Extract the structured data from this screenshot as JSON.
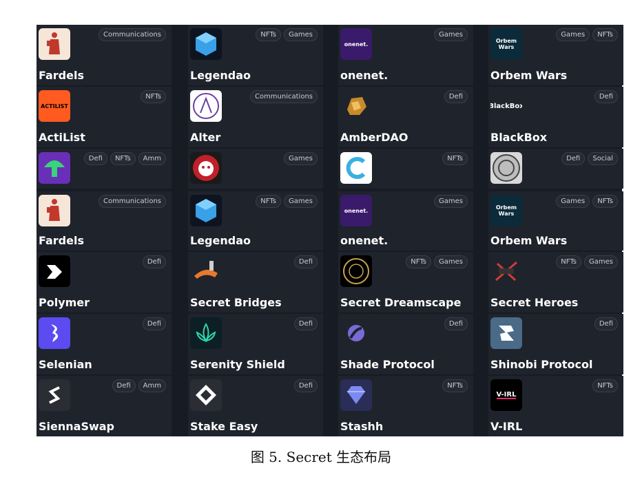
{
  "caption": "图 5. Secret 生态布局",
  "colors": {
    "figure_bg": "#171b23",
    "card_bg": "#1f232c",
    "tag_border": "#3a3f49",
    "text": "#ffffff"
  },
  "rows": [
    [
      {
        "name": "Fardels",
        "tags": [
          "Communications"
        ],
        "logo": {
          "icon": "fardels-figure-icon",
          "bg": "#f5e6d8",
          "text": ""
        }
      },
      {
        "name": "Legendao",
        "tags": [
          "NFTs",
          "Games"
        ],
        "logo": {
          "icon": "legendao-cube-icon",
          "bg": "#0d1420",
          "text": ""
        }
      },
      {
        "name": "onenet.",
        "tags": [
          "Games"
        ],
        "logo": {
          "icon": "onenet-logo-icon",
          "bg": "#3a1a6a",
          "text": "onenet."
        }
      },
      {
        "name": "Orbem Wars",
        "tags": [
          "Games",
          "NFTs"
        ],
        "logo": {
          "icon": "orbem-wars-logo-icon",
          "bg": "#0b2a3a",
          "text": "Orbem Wars"
        }
      }
    ],
    [
      {
        "name": "ActiList",
        "tags": [
          "NFTs"
        ],
        "logo": {
          "icon": "actilist-logo-icon",
          "bg": "#ff5a1f",
          "text": "ACTILIST"
        }
      },
      {
        "name": "Alter",
        "tags": [
          "Communications"
        ],
        "logo": {
          "icon": "alter-a-icon",
          "bg": "#ffffff",
          "text": ""
        }
      },
      {
        "name": "AmberDAO",
        "tags": [
          "Defi"
        ],
        "logo": {
          "icon": "amber-stone-icon",
          "bg": "#1f232c",
          "text": ""
        }
      },
      {
        "name": "BlackBox",
        "tags": [
          "Defi"
        ],
        "logo": {
          "icon": "blackbox-logo-icon",
          "bg": "#1f232c",
          "text": "BlackBox"
        }
      }
    ],
    [
      {
        "name": "",
        "tags": [
          "Defi",
          "NFTs",
          "Amm"
        ],
        "logo": {
          "icon": "mushroom-icon",
          "bg": "#6a2fb8",
          "text": ""
        }
      },
      {
        "name": "",
        "tags": [
          "Games"
        ],
        "logo": {
          "icon": "demon-mask-icon",
          "bg": "#1a1a1a",
          "text": ""
        }
      },
      {
        "name": "",
        "tags": [
          "NFTs"
        ],
        "logo": {
          "icon": "c-logo-icon",
          "bg": "#ffffff",
          "text": ""
        }
      },
      {
        "name": "",
        "tags": [
          "Defi",
          "Social"
        ],
        "logo": {
          "icon": "coin-seal-icon",
          "bg": "#d8d8d8",
          "text": ""
        }
      }
    ],
    [
      {
        "name": "Fardels",
        "tags": [
          "Communications"
        ],
        "logo": {
          "icon": "fardels-figure-icon",
          "bg": "#f5e6d8",
          "text": ""
        }
      },
      {
        "name": "Legendao",
        "tags": [
          "NFTs",
          "Games"
        ],
        "logo": {
          "icon": "legendao-cube-icon",
          "bg": "#0d1420",
          "text": ""
        }
      },
      {
        "name": "onenet.",
        "tags": [
          "Games"
        ],
        "logo": {
          "icon": "onenet-logo-icon",
          "bg": "#3a1a6a",
          "text": "onenet."
        }
      },
      {
        "name": "Orbem Wars",
        "tags": [
          "Games",
          "NFTs"
        ],
        "logo": {
          "icon": "orbem-wars-logo-icon",
          "bg": "#0b2a3a",
          "text": "Orbem Wars"
        }
      }
    ],
    [
      {
        "name": "Polymer",
        "tags": [
          "Defi"
        ],
        "logo": {
          "icon": "polymer-logo-icon",
          "bg": "#000000",
          "text": ""
        }
      },
      {
        "name": "Secret Bridges",
        "tags": [
          "Defi"
        ],
        "logo": {
          "icon": "bridge-icon",
          "bg": "#1f232c",
          "text": ""
        }
      },
      {
        "name": "Secret Dreamscape",
        "tags": [
          "NFTs",
          "Games"
        ],
        "logo": {
          "icon": "dreamscape-emblem-icon",
          "bg": "#000000",
          "text": ""
        }
      },
      {
        "name": "Secret Heroes",
        "tags": [
          "NFTs",
          "Games"
        ],
        "logo": {
          "icon": "heroes-emblem-icon",
          "bg": "#1f232c",
          "text": ""
        }
      }
    ],
    [
      {
        "name": "Selenian",
        "tags": [
          "Defi"
        ],
        "logo": {
          "icon": "selenian-logo-icon",
          "bg": "#5b4bf0",
          "text": ""
        }
      },
      {
        "name": "Serenity Shield",
        "tags": [
          "Defi"
        ],
        "logo": {
          "icon": "lotus-icon",
          "bg": "#0b1f24",
          "text": ""
        }
      },
      {
        "name": "Shade Protocol",
        "tags": [
          "Defi"
        ],
        "logo": {
          "icon": "shade-orb-icon",
          "bg": "#1f232c",
          "text": ""
        }
      },
      {
        "name": "Shinobi Protocol",
        "tags": [
          "Defi"
        ],
        "logo": {
          "icon": "shinobi-logo-icon",
          "bg": "#4a6a88",
          "text": ""
        }
      }
    ],
    [
      {
        "name": "SiennaSwap",
        "tags": [
          "Defi",
          "Amm"
        ],
        "logo": {
          "icon": "sienna-s-icon",
          "bg": "#2a2d33",
          "text": ""
        }
      },
      {
        "name": "Stake Easy",
        "tags": [
          "Defi"
        ],
        "logo": {
          "icon": "stake-easy-icon",
          "bg": "#2a2d33",
          "text": ""
        }
      },
      {
        "name": "Stashh",
        "tags": [
          "NFTs"
        ],
        "logo": {
          "icon": "diamond-icon",
          "bg": "#2a2d55",
          "text": ""
        }
      },
      {
        "name": "V-IRL",
        "tags": [
          "NFTs"
        ],
        "logo": {
          "icon": "virl-logo-icon",
          "bg": "#000000",
          "text": "V-IRL"
        }
      }
    ]
  ]
}
